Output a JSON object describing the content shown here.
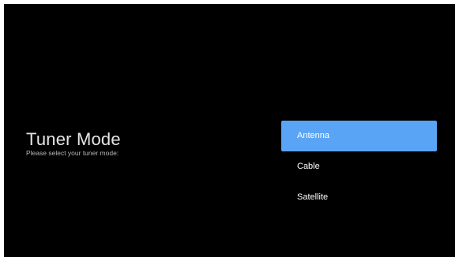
{
  "page": {
    "title": "Tuner Mode",
    "subtitle": "Please select your tuner mode:"
  },
  "menu": {
    "selected_color": "#59a4f5",
    "items": [
      {
        "label": "Antenna",
        "selected": true
      },
      {
        "label": "Cable",
        "selected": false
      },
      {
        "label": "Satellite",
        "selected": false
      }
    ]
  }
}
